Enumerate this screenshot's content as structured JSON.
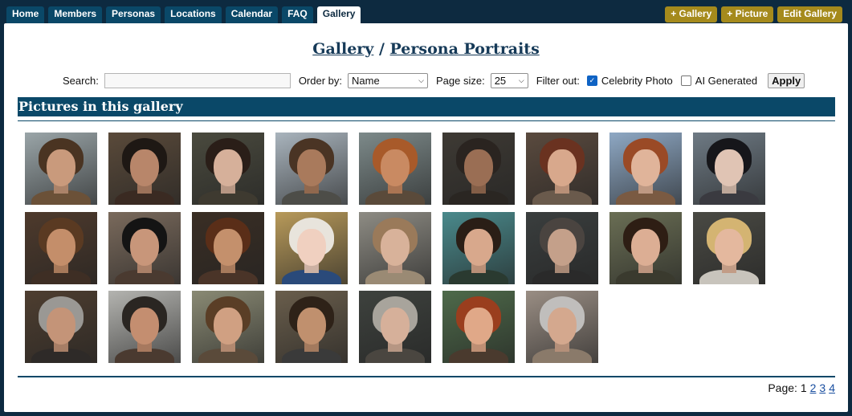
{
  "nav": {
    "tabs": [
      {
        "label": "Home"
      },
      {
        "label": "Members"
      },
      {
        "label": "Personas"
      },
      {
        "label": "Locations"
      },
      {
        "label": "Calendar"
      },
      {
        "label": "FAQ"
      },
      {
        "label": "Gallery",
        "active": true
      }
    ],
    "actions": [
      {
        "label": "+ Gallery"
      },
      {
        "label": "+ Picture"
      },
      {
        "label": "Edit Gallery"
      }
    ]
  },
  "breadcrumb": {
    "parent": "Gallery",
    "separator": " / ",
    "current": "Persona Portraits"
  },
  "filters": {
    "search_label": "Search:",
    "search_value": "",
    "order_label": "Order by:",
    "order_value": "Name",
    "page_size_label": "Page size:",
    "page_size_value": "25",
    "filter_out_label": "Filter out:",
    "celebrity_label": "Celebrity Photo",
    "celebrity_checked": true,
    "ai_label": "AI Generated",
    "ai_checked": false,
    "apply_label": "Apply"
  },
  "section_title": "Pictures in this gallery",
  "pictures": [
    {
      "name": "portrait-1",
      "colors": [
        "#9aa5a8",
        "#4a3422",
        "#c99a7c",
        "#6b5138"
      ]
    },
    {
      "name": "portrait-2",
      "colors": [
        "#5a4a3a",
        "#1e1814",
        "#b8866a",
        "#3a2a22"
      ]
    },
    {
      "name": "portrait-3",
      "colors": [
        "#4a4a3e",
        "#2a1e18",
        "#d6b09a",
        "#3e3a30"
      ]
    },
    {
      "name": "portrait-4",
      "colors": [
        "#a9b4bd",
        "#4a3424",
        "#a97a5c",
        "#4d4d48"
      ]
    },
    {
      "name": "portrait-5",
      "colors": [
        "#7d8a8a",
        "#a85a2a",
        "#c98a62",
        "#5a4a3a"
      ]
    },
    {
      "name": "portrait-6",
      "colors": [
        "#3e3a34",
        "#2a2420",
        "#9a6e54",
        "#2a2622"
      ]
    },
    {
      "name": "portrait-7",
      "colors": [
        "#5a4a3e",
        "#6a3220",
        "#d8a88c",
        "#6a5a4c"
      ]
    },
    {
      "name": "portrait-8",
      "colors": [
        "#8ea8c4",
        "#9a4a26",
        "#e0b49a",
        "#7a5a42"
      ]
    },
    {
      "name": "portrait-9",
      "colors": [
        "#6e7a84",
        "#16161a",
        "#e0c4b4",
        "#3a3a40"
      ]
    },
    {
      "name": "portrait-10",
      "colors": [
        "#4e3a2c",
        "#5a3a22",
        "#c48e6a",
        "#3e2e24"
      ]
    },
    {
      "name": "portrait-11",
      "colors": [
        "#7a6a5c",
        "#141414",
        "#c8967a",
        "#4a3a30"
      ]
    },
    {
      "name": "portrait-12",
      "colors": [
        "#3a2e24",
        "#5a2e18",
        "#c4906c",
        "#4a3428"
      ]
    },
    {
      "name": "portrait-13",
      "colors": [
        "#b89a5a",
        "#e8e4dc",
        "#f0d0c0",
        "#2a4a7a"
      ]
    },
    {
      "name": "portrait-14",
      "colors": [
        "#8e8c84",
        "#9a7a5a",
        "#d8b29a",
        "#9a8a74"
      ]
    },
    {
      "name": "portrait-15",
      "colors": [
        "#4a8a8c",
        "#2a1e16",
        "#d8a88c",
        "#2a3a30"
      ]
    },
    {
      "name": "portrait-16",
      "colors": [
        "#3a3e3e",
        "#4a4440",
        "#c4a08a",
        "#2a2a2a"
      ]
    },
    {
      "name": "portrait-17",
      "colors": [
        "#6a6e54",
        "#2e1e14",
        "#dcae94",
        "#3a3a2e"
      ]
    },
    {
      "name": "portrait-18",
      "colors": [
        "#4a4a44",
        "#d4b472",
        "#e4b89e",
        "#c8c4bc"
      ]
    },
    {
      "name": "portrait-19",
      "colors": [
        "#4e3e30",
        "#9a9894",
        "#c49478",
        "#2e2a28"
      ]
    },
    {
      "name": "portrait-20",
      "colors": [
        "#b4b4b0",
        "#2a2622",
        "#c48e70",
        "#4a3a30"
      ]
    },
    {
      "name": "portrait-21",
      "colors": [
        "#8a8a74",
        "#5a3e26",
        "#d0a082",
        "#5a4a3a"
      ]
    },
    {
      "name": "portrait-22",
      "colors": [
        "#6a5e4c",
        "#2e2218",
        "#c0906e",
        "#3a3a3a"
      ]
    },
    {
      "name": "portrait-23",
      "colors": [
        "#3e423e",
        "#a8a49c",
        "#d6b09a",
        "#4a4640"
      ]
    },
    {
      "name": "portrait-24",
      "colors": [
        "#4e6a4a",
        "#9a3e1e",
        "#e0a888",
        "#4a3a2e"
      ]
    },
    {
      "name": "portrait-25",
      "colors": [
        "#9a8e84",
        "#c0bebc",
        "#d4a88e",
        "#8a7a6a"
      ]
    }
  ],
  "pager": {
    "label": "Page:",
    "current": "1",
    "links": [
      "2",
      "3",
      "4"
    ]
  }
}
